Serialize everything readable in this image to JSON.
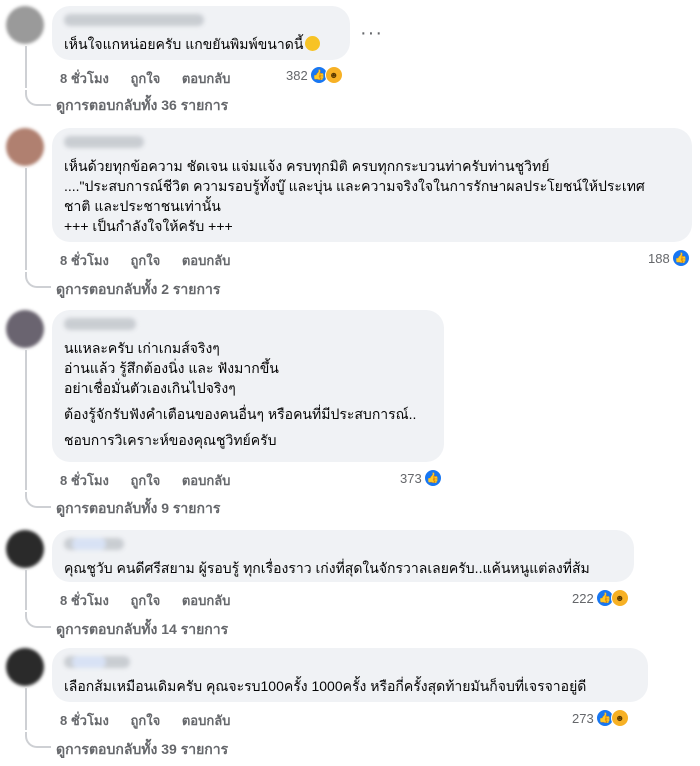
{
  "comments": [
    {
      "lines": [
        "เห็นใจแกหน่อยครับ แกขยันพิมพ์ขนาดนี้"
      ],
      "has_emoji": true,
      "time": "8 ชั่วโมง",
      "like": "ถูกใจ",
      "reply": "ตอบกลับ",
      "reaction_count": "382",
      "reactions": [
        "like-icon",
        "haha-icon"
      ],
      "replies": "ดูการตอบกลับทั้ง 36 รายการ",
      "more": "···"
    },
    {
      "lines": [
        "เห็นด้วยทุกข้อความ ชัดเจน แจ่มแจ้ง ครบทุกมิติ ครบทุกกระบวนท่าครับท่านชูวิทย์",
        "....\"ประสบการณ์ชีวิต ความรอบรู้ทั้งบู๊ และบุ่น และความจริงใจในการรักษาผลประโยชน์ให้ประเทศ",
        "ชาติ และประชาชนเท่านั้น",
        "+++ เป็นกำลังใจให้ครับ +++"
      ],
      "time": "8 ชั่วโมง",
      "like": "ถูกใจ",
      "reply": "ตอบกลับ",
      "reaction_count": "188",
      "reactions": [
        "like-icon"
      ],
      "replies": "ดูการตอบกลับทั้ง 2 รายการ"
    },
    {
      "lines": [
        "นแหละครับ เก่าเกมส์จริงๆ",
        "อ่านแล้ว รู้สึกต้องนิ่ง และ ฟังมากขึ้น",
        "อย่าเชื่อมั่นตัวเองเกินไปจริงๆ",
        "ต้องรู้จักรับฟังคำเตือนของคนอื่นๆ หรือคนที่มีประสบการณ์..",
        "ชอบการวิเคราะห์ของคุณชูวิทย์ครับ"
      ],
      "time": "8 ชั่วโมง",
      "like": "ถูกใจ",
      "reply": "ตอบกลับ",
      "reaction_count": "373",
      "reactions": [
        "like-icon"
      ],
      "replies": "ดูการตอบกลับทั้ง 9 รายการ"
    },
    {
      "lines": [
        "คุณชูวับ คนดีศรีสยาม ผู้รอบรู้ ทุกเรื่องราว เก่งที่สุดในจักรวาลเลยครับ..แค้นหนูแต่ลงที่ส้ม"
      ],
      "time": "8 ชั่วโมง",
      "like": "ถูกใจ",
      "reply": "ตอบกลับ",
      "reaction_count": "222",
      "reactions": [
        "like-icon",
        "haha-icon"
      ],
      "replies": "ดูการตอบกลับทั้ง 14 รายการ"
    },
    {
      "lines": [
        "เลือกส้มเหมือนเดิมครับ คุณจะรบ100ครั้ง 1000ครั้ง หรือกี่ครั้งสุดท้ายมันก็จบที่เจรจาอยู่ดี"
      ],
      "time": "8 ชั่วโมง",
      "like": "ถูกใจ",
      "reply": "ตอบกลับ",
      "reaction_count": "273",
      "reactions": [
        "like-icon",
        "haha-icon"
      ],
      "replies": "ดูการตอบกลับทั้ง 39 รายการ"
    }
  ],
  "colors": {
    "like": "#1877f2",
    "haha": "#f7b125",
    "bubble": "#f0f2f5",
    "meta": "#65676b"
  }
}
